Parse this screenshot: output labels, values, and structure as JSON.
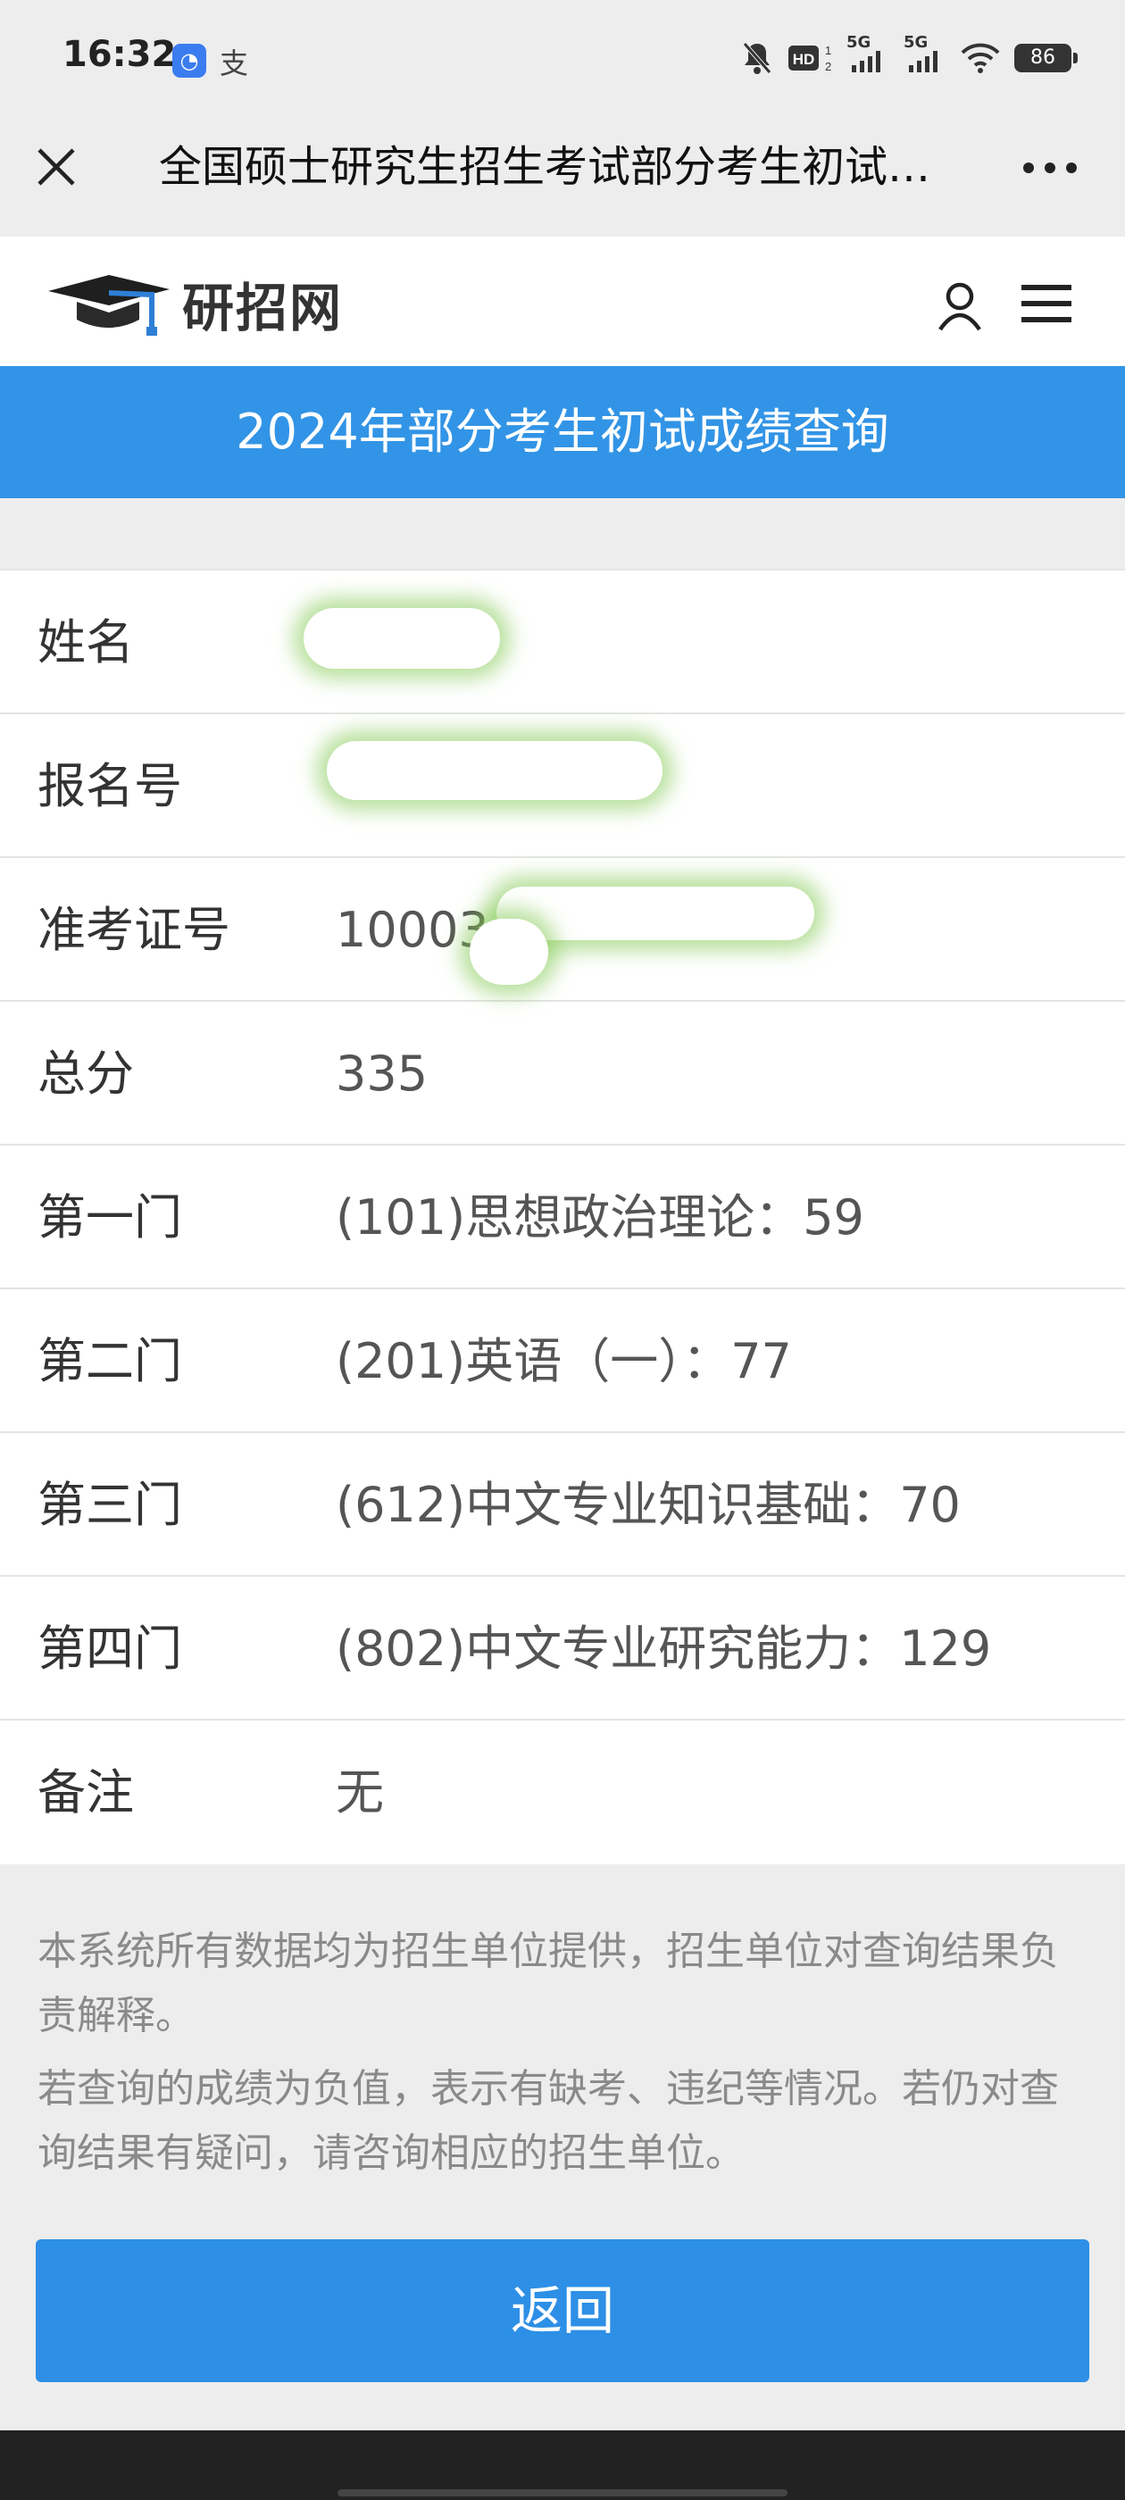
{
  "status_bar": {
    "time": "16:32",
    "app_icon_1": "browser-icon",
    "app_icon_2": "支",
    "network_1": "5G",
    "network_2": "5G",
    "battery": "86"
  },
  "nav": {
    "title": "全国硕士研究生招生考试部分考生初试成绩查询",
    "close_icon": "close-icon",
    "more_icon": "more-icon"
  },
  "site": {
    "logo_text": "研招网",
    "user_icon": "user-icon",
    "menu_icon": "menu-icon"
  },
  "banner": {
    "title": "2024年部分考生初试成绩查询"
  },
  "table": {
    "rows": [
      {
        "label": "姓名",
        "value": ""
      },
      {
        "label": "报名号",
        "value": ""
      },
      {
        "label": "准考证号",
        "value": "10003"
      },
      {
        "label": "总分",
        "value": "335"
      },
      {
        "label": "第一门",
        "value": "(101)思想政治理论：59"
      },
      {
        "label": "第二门",
        "value": "(201)英语（一）：77"
      },
      {
        "label": "第三门",
        "value": "(612)中文专业知识基础：70"
      },
      {
        "label": "第四门",
        "value": "(802)中文专业研究能力：129"
      },
      {
        "label": "备注",
        "value": "无"
      }
    ]
  },
  "notes": [
    "本系统所有数据均为招生单位提供，招生单位对查询结果负责解释。",
    "若查询的成绩为负值，表示有缺考、违纪等情况。若仍对查询结果有疑问，请咨询相应的招生单位。"
  ],
  "back_button": "返回",
  "colors": {
    "banner": "#3294e6",
    "button": "#2d8fe6",
    "background": "#ededed"
  }
}
